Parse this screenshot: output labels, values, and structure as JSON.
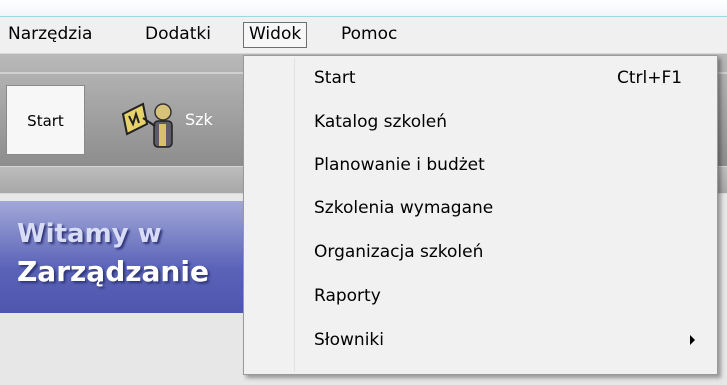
{
  "menubar": {
    "items": [
      {
        "label": "Narzędzia"
      },
      {
        "label": "Dodatki"
      },
      {
        "label": "Widok"
      },
      {
        "label": "Pomoc"
      }
    ]
  },
  "toolbar": {
    "start_label": "Start",
    "item_label": "Szk"
  },
  "welcome": {
    "line1": "Witamy w",
    "line2": "Zarządzanie"
  },
  "dropdown": {
    "items": [
      {
        "label": "Start",
        "shortcut": "Ctrl+F1"
      },
      {
        "label": "Katalog szkoleń"
      },
      {
        "label": "Planowanie i budżet"
      },
      {
        "label": "Szkolenia wymagane"
      },
      {
        "label": "Organizacja szkoleń"
      },
      {
        "label": "Raporty"
      },
      {
        "label": "Słowniki",
        "submenu": "chevron-right-icon"
      }
    ]
  }
}
